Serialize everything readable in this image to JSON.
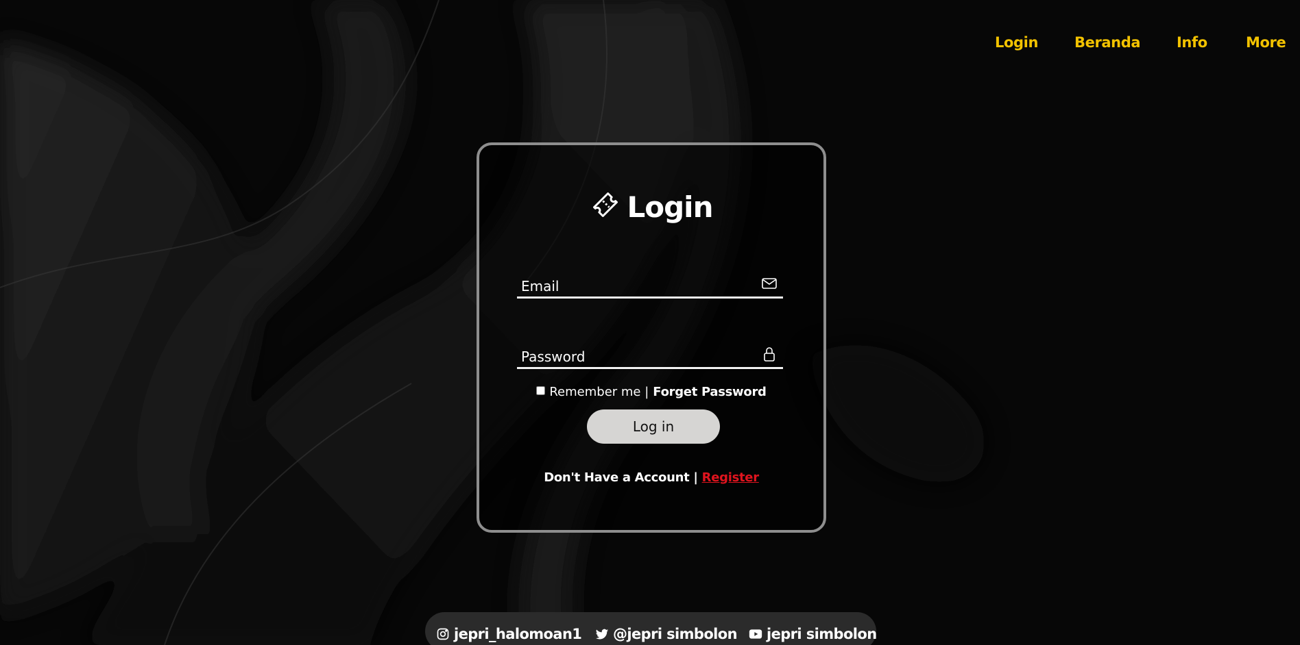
{
  "colors": {
    "accent": "#f2c200",
    "register_link": "#e0141e",
    "card_border": "#8e8e8e",
    "button_bg": "#d6d5d3",
    "footer_bg": "#2b2b2b",
    "background": "#080808"
  },
  "nav": {
    "items": [
      {
        "label": "Login"
      },
      {
        "label": "Beranda"
      },
      {
        "label": "Info"
      },
      {
        "label": "More"
      }
    ]
  },
  "login_form": {
    "title": "Login",
    "title_icon": "ticket-icon",
    "email": {
      "placeholder": "Email",
      "value": "",
      "icon": "mail-icon"
    },
    "password": {
      "placeholder": "Password",
      "value": "",
      "icon": "lock-icon"
    },
    "remember_label": "Remember me |",
    "remember_checked": false,
    "forget_label": "Forget Password",
    "submit_label": "Log in",
    "no_account_text": "Don't Have a Account |",
    "register_label": "Register"
  },
  "social": {
    "instagram": {
      "icon": "instagram-icon",
      "handle": "jepri_halomoan1"
    },
    "twitter": {
      "icon": "twitter-icon",
      "handle": "@jepri simbolon"
    },
    "youtube": {
      "icon": "youtube-icon",
      "handle": "jepri simbolon"
    }
  }
}
